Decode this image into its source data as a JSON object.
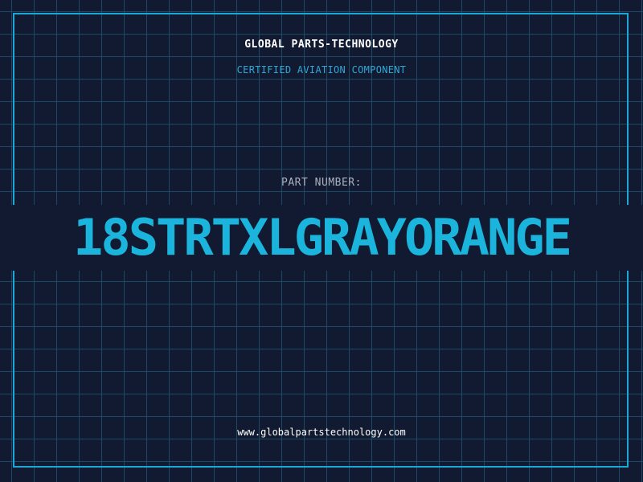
{
  "company": "GLOBAL PARTS-TECHNOLOGY",
  "subtitle": "CERTIFIED AVIATION COMPONENT",
  "part_number_label": "PART NUMBER:",
  "part_number": "18STRTXLGRAYORANGE",
  "website": "www.globalpartstechnology.com",
  "colors": {
    "background": "#111a30",
    "grid": "#1c4a63",
    "accent": "#1ab4dc",
    "label": "#a9b1bf"
  }
}
